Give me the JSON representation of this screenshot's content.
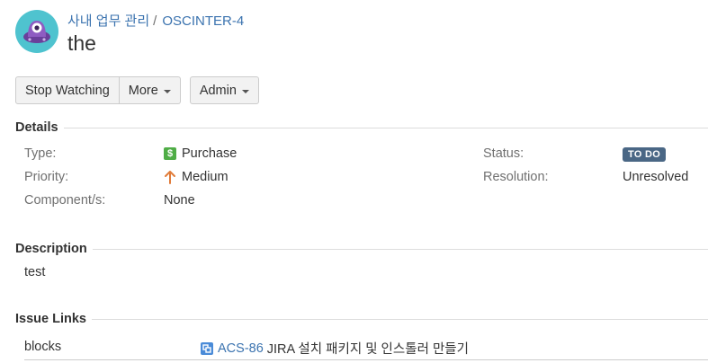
{
  "breadcrumb": {
    "project": "사내 업무 관리",
    "separator": "/",
    "issue_key": "OSCINTER-4"
  },
  "issue": {
    "title": "the"
  },
  "toolbar": {
    "stop_watching": "Stop Watching",
    "more": "More",
    "admin": "Admin"
  },
  "details": {
    "heading": "Details",
    "type_label": "Type:",
    "type_value": "Purchase",
    "type_icon_glyph": "$",
    "priority_label": "Priority:",
    "priority_value": "Medium",
    "components_label": "Component/s:",
    "components_value": "None",
    "status_label": "Status:",
    "status_value": "TO DO",
    "resolution_label": "Resolution:",
    "resolution_value": "Unresolved"
  },
  "description": {
    "heading": "Description",
    "text": "test"
  },
  "issue_links": {
    "heading": "Issue Links",
    "relation": "blocks",
    "link_key": "ACS-86",
    "link_summary": "JIRA 설치 패키지 및 인스톨러 만들기"
  },
  "colors": {
    "link": "#3b73af",
    "status_lozenge": "#4a6785",
    "type_icon": "#4fad46",
    "priority_icon": "#e07b39"
  }
}
